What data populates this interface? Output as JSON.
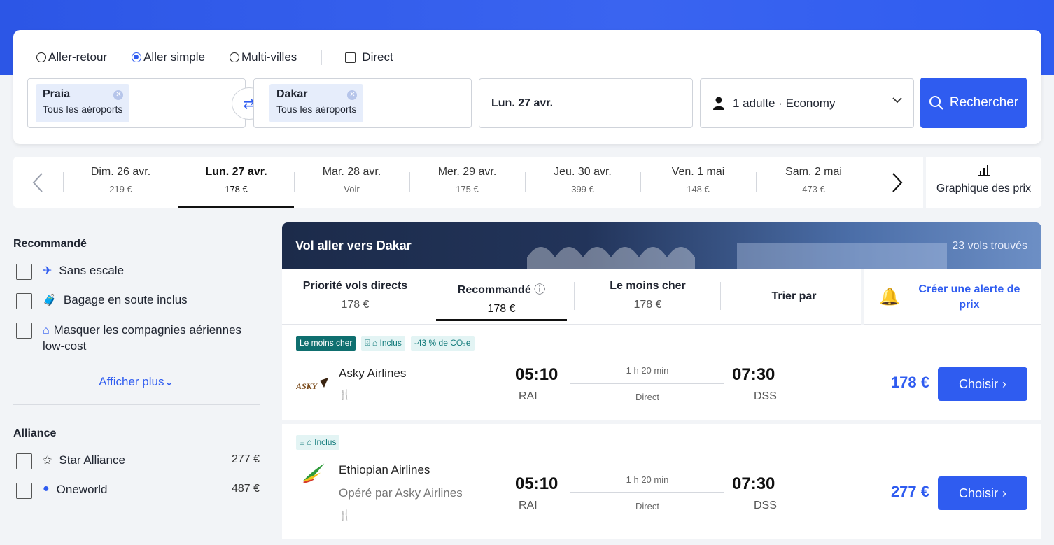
{
  "trip_types": {
    "round_trip": "Aller-retour",
    "one_way": "Aller simple",
    "multi_city": "Multi-villes",
    "direct": "Direct"
  },
  "origin": {
    "city": "Praia",
    "sub": "Tous les aéroports"
  },
  "destination": {
    "city": "Dakar",
    "sub": "Tous les aéroports"
  },
  "date": "Lun. 27 avr.",
  "passengers": "1 adulte · Economy",
  "search_label": "Rechercher",
  "date_strip": [
    {
      "date": "Dim. 26 avr.",
      "price": "219 €"
    },
    {
      "date": "Lun. 27 avr.",
      "price": "178 €"
    },
    {
      "date": "Mar. 28 avr.",
      "price": "Voir"
    },
    {
      "date": "Mer. 29 avr.",
      "price": "175 €"
    },
    {
      "date": "Jeu. 30 avr.",
      "price": "399 €"
    },
    {
      "date": "Ven. 1 mai",
      "price": "148 €"
    },
    {
      "date": "Sam. 2 mai",
      "price": "473 €"
    }
  ],
  "price_chart_label": "Graphique des prix",
  "filters": {
    "recommended_title": "Recommandé",
    "nonstop": "Sans escale",
    "baggage": "Bagage en soute inclus",
    "lowcost": "Masquer les compagnies aériennes low-cost",
    "show_more": "Afficher plus",
    "alliance_title": "Alliance",
    "alliances": [
      {
        "name": "Star Alliance",
        "price": "277 €"
      },
      {
        "name": "Oneworld",
        "price": "487 €"
      }
    ]
  },
  "results": {
    "title": "Vol aller vers Dakar",
    "count": "23 vols trouvés",
    "sort": {
      "direct": {
        "label": "Priorité vols directs",
        "price": "178 €"
      },
      "recommended": {
        "label": "Recommandé",
        "price": "178 €"
      },
      "cheapest": {
        "label": "Le moins cher",
        "price": "178 €"
      },
      "sort_by": "Trier par"
    },
    "alert": "Créer une alerte de prix",
    "flights": [
      {
        "tags": [
          "Le moins cher",
          "Inclus",
          "-43 % de CO₂e"
        ],
        "airline": "Asky Airlines",
        "operated": "",
        "dep_time": "05:10",
        "dep_code": "RAI",
        "duration": "1 h 20 min",
        "stops": "Direct",
        "arr_time": "07:30",
        "arr_code": "DSS",
        "price": "178 €"
      },
      {
        "tags": [
          "Inclus"
        ],
        "airline": "Ethiopian Airlines",
        "operated": "Opéré par Asky Airlines",
        "dep_time": "05:10",
        "dep_code": "RAI",
        "duration": "1 h 20 min",
        "stops": "Direct",
        "arr_time": "07:30",
        "arr_code": "DSS",
        "price": "277 €"
      }
    ],
    "choose_label": "Choisir"
  },
  "icons": {
    "swap": "swap-icon",
    "user": "user-icon",
    "search": "search-icon",
    "chart": "bar-chart-icon",
    "plane": "plane-icon",
    "bag": "bag-icon",
    "tag": "tag-icon",
    "star": "star-alliance-icon",
    "globe": "oneworld-icon",
    "bell": "bell-icon",
    "meal": "meal-icon",
    "info": "info-icon"
  }
}
